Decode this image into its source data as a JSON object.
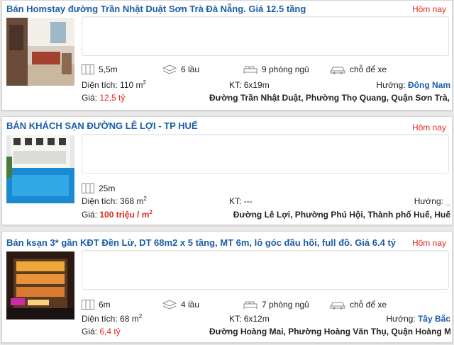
{
  "listings": [
    {
      "title": "Bán Homstay đường Trần Nhật Duật Sơn Trà Đà Nẵng. Giá 12.5 tầng",
      "date": "Hôm nay",
      "features": {
        "width": "5,5m",
        "floors": "6 lầu",
        "bedrooms": "9 phòng ngủ",
        "parking": "chỗ để xe"
      },
      "area_label": "Diện tích:",
      "area_value": "110 m",
      "area_unit_sup": "2",
      "kt_label": "KT:",
      "kt_value": "6x19m",
      "direction_label": "Hướng:",
      "direction_value": "Đông Nam",
      "price_label": "Giá:",
      "price_value": "12,5 tỷ",
      "price_unit_sup": "",
      "address": "Đường Trần Nhật Duật, Phường Thọ Quang, Quận Sơn Trà, Đà"
    },
    {
      "title": "BÁN KHÁCH SẠN ĐƯỜNG LÊ LỢI - TP HUẾ",
      "date": "Hôm nay",
      "features": {
        "width": "25m"
      },
      "area_label": "Diện tích:",
      "area_value": "368 m",
      "area_unit_sup": "2",
      "kt_label": "KT:",
      "kt_value": "---",
      "direction_label": "Hướng:",
      "direction_value": "_",
      "price_label": "Giá:",
      "price_value": "100 triệu / m",
      "price_unit_sup": "2",
      "address": "Đường Lê Lợi, Phường Phú Hội, Thành phố Huế, Huế"
    },
    {
      "title": "Bán ksạn 3* gần KĐT Đền Lừ, DT 68m2 x 5 tầng, MT 6m, lô góc đầu hồi, full đồ. Giá 6.4 tỷ",
      "date": "Hôm nay",
      "features": {
        "width": "6m",
        "floors": "4 lầu",
        "bedrooms": "7 phòng ngủ",
        "parking": "chỗ để xe"
      },
      "area_label": "Diện tích:",
      "area_value": "68 m",
      "area_unit_sup": "2",
      "kt_label": "KT:",
      "kt_value": "6x12m",
      "direction_label": "Hướng:",
      "direction_value": "Tây Bắc",
      "price_label": "Giá:",
      "price_value": "6,4 tỷ",
      "price_unit_sup": "",
      "address": "Đường Hoàng Mai, Phường Hoàng Văn Thụ, Quận Hoàng Mai, Hà"
    }
  ],
  "icons": {
    "width": "frontage-width-icon",
    "floors": "floors-stack-icon",
    "bedrooms": "bed-icon",
    "parking": "car-icon"
  },
  "colors": {
    "title": "#1b5ea8",
    "date": "#e02a1f",
    "price": "#e02a1f",
    "direction": "#1b5ea8"
  }
}
